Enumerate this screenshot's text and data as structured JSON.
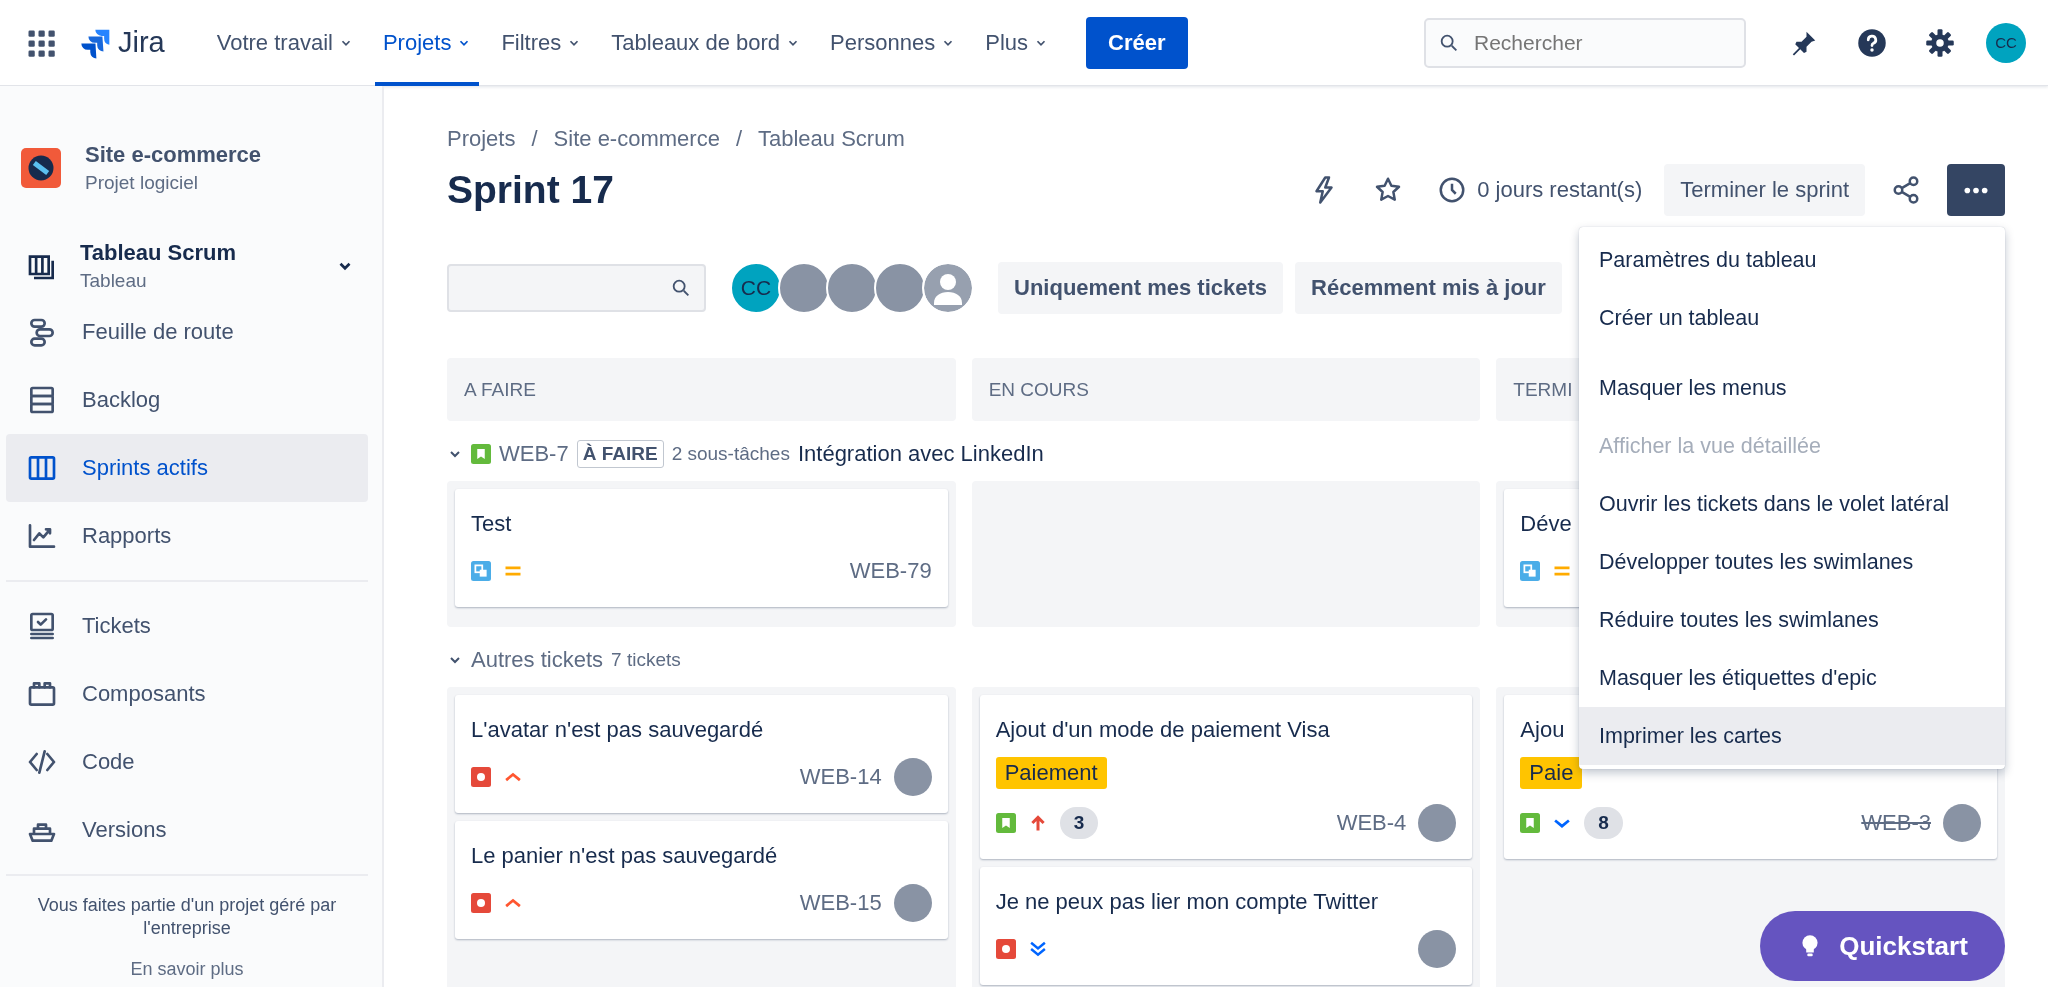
{
  "topbar": {
    "logo": "Jira",
    "nav": [
      {
        "label": "Votre travail",
        "selected": false
      },
      {
        "label": "Projets",
        "selected": true
      },
      {
        "label": "Filtres",
        "selected": false
      },
      {
        "label": "Tableaux de bord",
        "selected": false
      },
      {
        "label": "Personnes",
        "selected": false
      },
      {
        "label": "Plus",
        "selected": false
      }
    ],
    "create_button": "Créer",
    "search": {
      "placeholder": "Rechercher"
    },
    "user_initials": "CC"
  },
  "sidebar": {
    "project": {
      "name": "Site e-commerce",
      "type": "Projet logiciel"
    },
    "board": {
      "name": "Tableau Scrum",
      "type": "Tableau",
      "expanded": true
    },
    "sections": [
      [
        {
          "label": "Feuille de route",
          "kind": "roadmap",
          "selected": false
        },
        {
          "label": "Backlog",
          "kind": "backlog",
          "selected": false
        },
        {
          "label": "Sprints actifs",
          "kind": "board",
          "selected": true
        },
        {
          "label": "Rapports",
          "kind": "reports",
          "selected": false
        }
      ],
      [
        {
          "label": "Tickets",
          "kind": "tickets",
          "selected": false
        },
        {
          "label": "Composants",
          "kind": "components",
          "selected": false
        },
        {
          "label": "Code",
          "kind": "code",
          "selected": false
        },
        {
          "label": "Versions",
          "kind": "versions",
          "selected": false
        }
      ]
    ],
    "footer": {
      "text": "Vous faites partie d'un projet géré par l'entreprise",
      "link": "En savoir plus"
    }
  },
  "breadcrumbs": {
    "separator": "/",
    "items": [
      "Projets",
      "Site e-commerce",
      "Tableau Scrum"
    ]
  },
  "header": {
    "title": "Sprint 17",
    "starred": false,
    "remaining": "0 jours restant(s)",
    "complete_button": "Terminer le sprint",
    "more_expanded": true
  },
  "toolbar": {
    "avatars": [
      {
        "kind": "initials",
        "initials": "CC"
      },
      {
        "kind": "photo"
      },
      {
        "kind": "photo"
      },
      {
        "kind": "photo"
      },
      {
        "kind": "default"
      }
    ],
    "quick_filters": [
      {
        "label": "Uniquement mes tickets",
        "selected": false
      },
      {
        "label": "Récemment mis à jour",
        "selected": false
      }
    ]
  },
  "columns": [
    "A FAIRE",
    "EN COURS",
    "TERMI"
  ],
  "swimlanes": [
    {
      "kind": "epic",
      "expanded": true,
      "type_icon": {
        "kind": "story"
      },
      "key": "WEB-7",
      "status": "À FAIRE",
      "subtasks": "2 sous-tâches",
      "title": "Intégration avec LinkedIn",
      "cells": [
        [
          {
            "title": "Test",
            "type_icon": {
              "kind": "subtask"
            },
            "priority_icon": {
              "kind": "medium"
            },
            "key": "WEB-79",
            "done": false,
            "assigned": false
          }
        ],
        [],
        [
          {
            "title": "Déve",
            "type_icon": {
              "kind": "subtask"
            },
            "priority_icon": {
              "kind": "medium"
            },
            "assigned": false
          }
        ]
      ]
    },
    {
      "kind": "group",
      "expanded": true,
      "title": "Autres tickets",
      "count": "7 tickets",
      "cells": [
        [
          {
            "title": "L'avatar n'est pas sauvegardé",
            "type_icon": {
              "kind": "bug"
            },
            "priority_icon": {
              "kind": "high"
            },
            "key": "WEB-14",
            "done": false,
            "assigned": true
          },
          {
            "title": "Le panier n'est pas sauvegardé",
            "type_icon": {
              "kind": "bug"
            },
            "priority_icon": {
              "kind": "high"
            },
            "key": "WEB-15",
            "done": false,
            "assigned": true
          }
        ],
        [
          {
            "title": "Ajout d'un mode de paiement Visa",
            "label": "Paiement",
            "type_icon": {
              "kind": "story"
            },
            "priority_icon": {
              "kind": "highest"
            },
            "count": "3",
            "key": "WEB-4",
            "done": false,
            "assigned": true
          },
          {
            "title": "Je ne peux pas lier mon compte Twitter",
            "type_icon": {
              "kind": "bug"
            },
            "priority_icon": {
              "kind": "lowest"
            },
            "assigned": true
          }
        ],
        [
          {
            "title": "Ajou",
            "label": "Paie",
            "type_icon": {
              "kind": "story"
            },
            "priority_icon": {
              "kind": "low"
            },
            "count": "8",
            "key": "WEB-3",
            "done": true,
            "assigned": true
          }
        ]
      ]
    }
  ],
  "menu": {
    "sections": [
      [
        {
          "label": "Paramètres du tableau",
          "disabled": false,
          "selected": false
        },
        {
          "label": "Créer un tableau",
          "disabled": false,
          "selected": false
        }
      ],
      [
        {
          "label": "Masquer les menus",
          "disabled": false,
          "selected": false
        },
        {
          "label": "Afficher la vue détaillée",
          "disabled": true,
          "selected": false
        },
        {
          "label": "Ouvrir les tickets dans le volet latéral",
          "disabled": false,
          "selected": false
        },
        {
          "label": "Développer toutes les swimlanes",
          "disabled": false,
          "selected": false
        },
        {
          "label": "Réduire toutes les swimlanes",
          "disabled": false,
          "selected": false
        },
        {
          "label": "Masquer les étiquettes d'epic",
          "disabled": false,
          "selected": false
        },
        {
          "label": "Imprimer les cartes",
          "disabled": false,
          "selected": true
        }
      ]
    ]
  },
  "quickstart": {
    "label": "Quickstart"
  }
}
